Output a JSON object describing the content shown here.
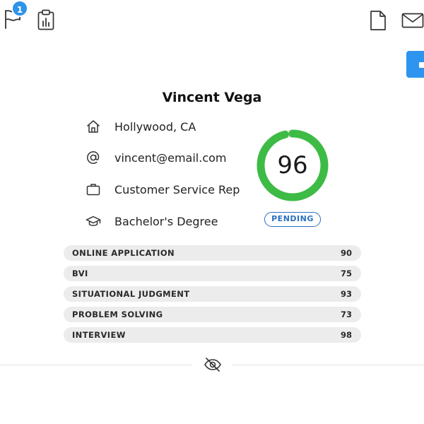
{
  "toolbar": {
    "flag_badge_count": "1"
  },
  "candidate": {
    "name": "Vincent Vega",
    "location": "Hollywood, CA",
    "email": "vincent@email.com",
    "job_title": "Customer Service Rep",
    "education": "Bachelor's Degree"
  },
  "overall_score": {
    "value": "96",
    "max": 100,
    "status": "PENDING",
    "ring_color": "#3dbb45",
    "status_color": "#2a6fc0"
  },
  "assessments": [
    {
      "label": "Online Application",
      "score": "90"
    },
    {
      "label": "BVI",
      "score": "75"
    },
    {
      "label": "Situational Judgment",
      "score": "93"
    },
    {
      "label": "Problem Solving",
      "score": "73"
    },
    {
      "label": "Interview",
      "score": "98"
    }
  ],
  "icons": {
    "flag": "flag-icon",
    "clipboard": "clipboard-chart-icon",
    "document": "document-icon",
    "mail": "mail-icon",
    "location": "home-icon",
    "email": "at-sign-icon",
    "job": "briefcase-icon",
    "education": "graduation-cap-icon",
    "visibility": "eye-off-icon"
  },
  "colors": {
    "accent": "#2d95f0",
    "ring": "#3dbb45",
    "row_background": "#ececec"
  }
}
